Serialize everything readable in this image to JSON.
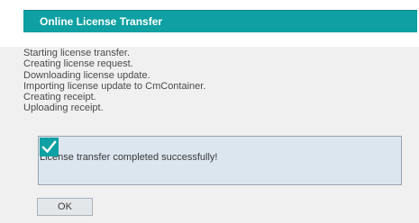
{
  "dialog": {
    "title": "Online License Transfer"
  },
  "log": [
    "Starting license transfer.",
    "Creating license request.",
    "Downloading license update.",
    "Importing license update to CmContainer.",
    "Creating receipt.",
    "Uploading receipt."
  ],
  "result": {
    "icon": "checkmark-icon",
    "message": "License transfer completed successfully!"
  },
  "buttons": {
    "ok_label": "OK"
  },
  "colors": {
    "accent": "#0ea0a2",
    "result_background": "#dce6ef",
    "panel_background": "#f0f0f0"
  }
}
